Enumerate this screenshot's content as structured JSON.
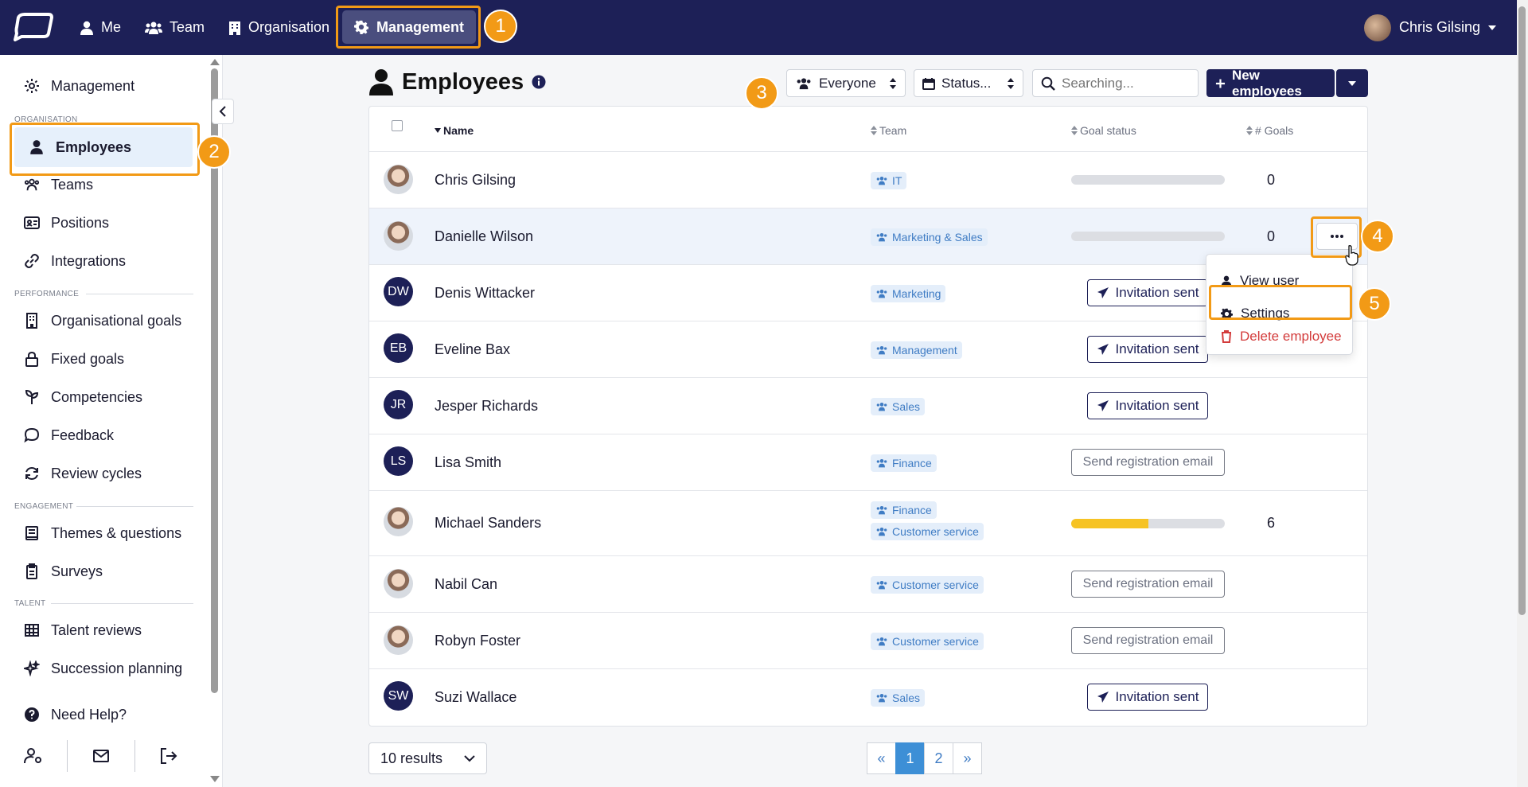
{
  "topnav": {
    "items": [
      {
        "label": "Me",
        "icon": "user-icon"
      },
      {
        "label": "Team",
        "icon": "users-icon"
      },
      {
        "label": "Organisation",
        "icon": "building-icon"
      },
      {
        "label": "Management",
        "icon": "gear-icon"
      }
    ],
    "user_name": "Chris Gilsing",
    "colors": {
      "navbar": "#1d2057",
      "accent": "#f29a16",
      "active_tab": "#4a4e7e"
    }
  },
  "sidebar": {
    "top_item": "Management",
    "sections": [
      {
        "label": "ORGANISATION",
        "items": [
          "Employees",
          "Teams",
          "Positions",
          "Integrations"
        ]
      },
      {
        "label": "PERFORMANCE",
        "items": [
          "Organisational goals",
          "Fixed goals",
          "Competencies",
          "Feedback",
          "Review cycles"
        ]
      },
      {
        "label": "ENGAGEMENT",
        "items": [
          "Themes & questions",
          "Surveys"
        ]
      },
      {
        "label": "TALENT",
        "items": [
          "Talent reviews",
          "Succession planning"
        ]
      }
    ],
    "active_item": "Employees",
    "help": "Need Help?"
  },
  "page": {
    "title": "Employees",
    "filter_group": "Everyone",
    "filter_status": "Status...",
    "search_placeholder": "Searching...",
    "new_button": "New employees"
  },
  "table": {
    "columns": [
      "Name",
      "Team",
      "Goal status",
      "# Goals"
    ],
    "rows": [
      {
        "name": "Chris Gilsing",
        "avatar": "photo",
        "teams": [
          "IT"
        ],
        "goal_progress": 0.0,
        "goals": "0"
      },
      {
        "name": "Danielle Wilson",
        "avatar": "photo",
        "teams": [
          "Marketing & Sales"
        ],
        "goal_progress": 0.0,
        "goals": "0"
      },
      {
        "name": "Denis Wittacker",
        "initials": "DW",
        "teams": [
          "Marketing"
        ],
        "status_button": "Invitation sent"
      },
      {
        "name": "Eveline Bax",
        "initials": "EB",
        "teams": [
          "Management"
        ],
        "status_button": "Invitation sent"
      },
      {
        "name": "Jesper Richards",
        "initials": "JR",
        "teams": [
          "Sales"
        ],
        "status_button": "Invitation sent"
      },
      {
        "name": "Lisa Smith",
        "initials": "LS",
        "teams": [
          "Finance"
        ],
        "status_button": "Send registration email"
      },
      {
        "name": "Michael Sanders",
        "avatar": "photo",
        "teams": [
          "Finance",
          "Customer service"
        ],
        "goal_progress": 0.5,
        "goals": "6"
      },
      {
        "name": "Nabil Can",
        "avatar": "photo",
        "teams": [
          "Customer service"
        ],
        "status_button": "Send registration email"
      },
      {
        "name": "Robyn Foster",
        "avatar": "photo",
        "teams": [
          "Customer service"
        ],
        "status_button": "Send registration email"
      },
      {
        "name": "Suzi Wallace",
        "initials": "SW",
        "teams": [
          "Sales"
        ],
        "status_button": "Invitation sent"
      }
    ]
  },
  "row_menu": {
    "items": [
      "View user",
      "Settings",
      "Delete employee"
    ]
  },
  "footer": {
    "results": "10 results",
    "pages": [
      "«",
      "1",
      "2",
      "»"
    ],
    "current_page": "1"
  },
  "badges": [
    "1",
    "2",
    "3",
    "4",
    "5"
  ]
}
